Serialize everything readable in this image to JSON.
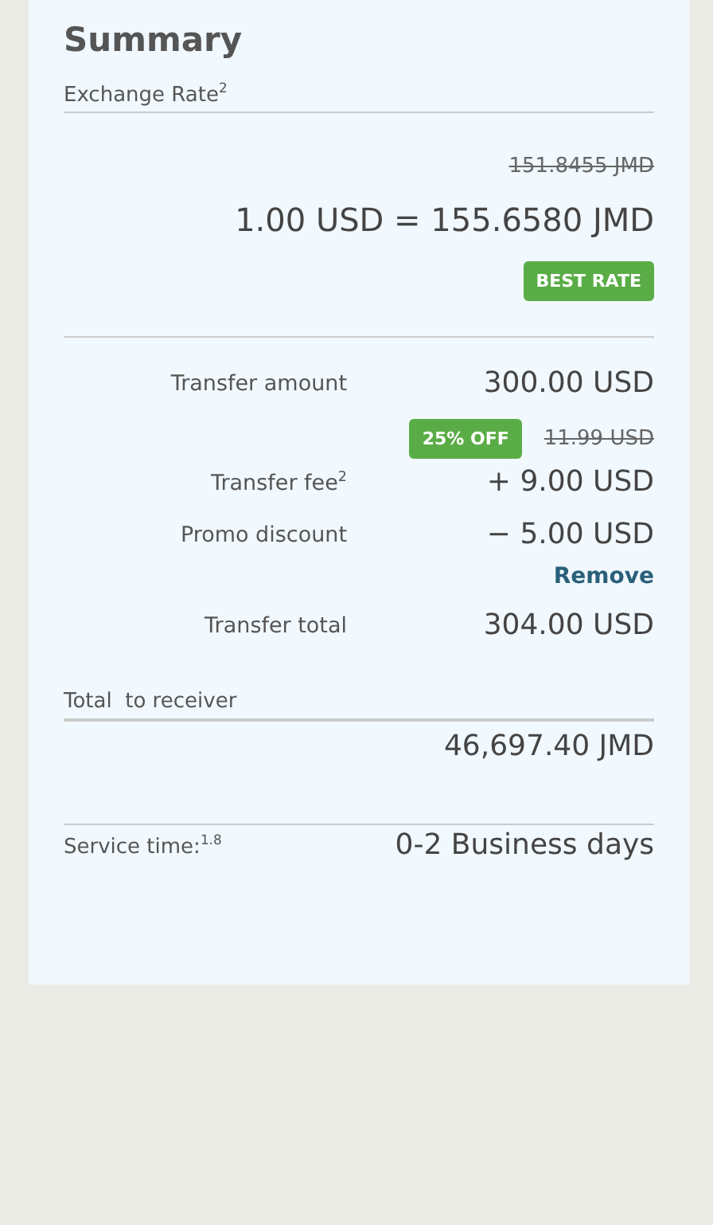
{
  "summary": {
    "title": "Summary",
    "exchange_rate": {
      "label": "Exchange Rate$^{2}$",
      "old_rate": "151.8455 JMD",
      "rate": "1.00 USD = 155.6580 JMD",
      "badge": "BEST RATE"
    },
    "lines": [
      {
        "label": "Transfer amount",
        "value": "300.00 USD"
      },
      {
        "label": "Transfer fee$^{2}$",
        "value": "+ 9.00 USD",
        "badge": "25% OFF",
        "old_value": "11.99 USD"
      },
      {
        "label": "Promo discount",
        "value": "− 5.00 USD",
        "link": "Remove"
      },
      {
        "label": "Transfer total",
        "value": "304.00 USD"
      }
    ],
    "receiver": {
      "label": "Total  to receiver",
      "value": "46,697.40 JMD"
    },
    "service_time": {
      "label": "Service time:$^{1.8}$",
      "value": "0-2 Business days"
    }
  }
}
